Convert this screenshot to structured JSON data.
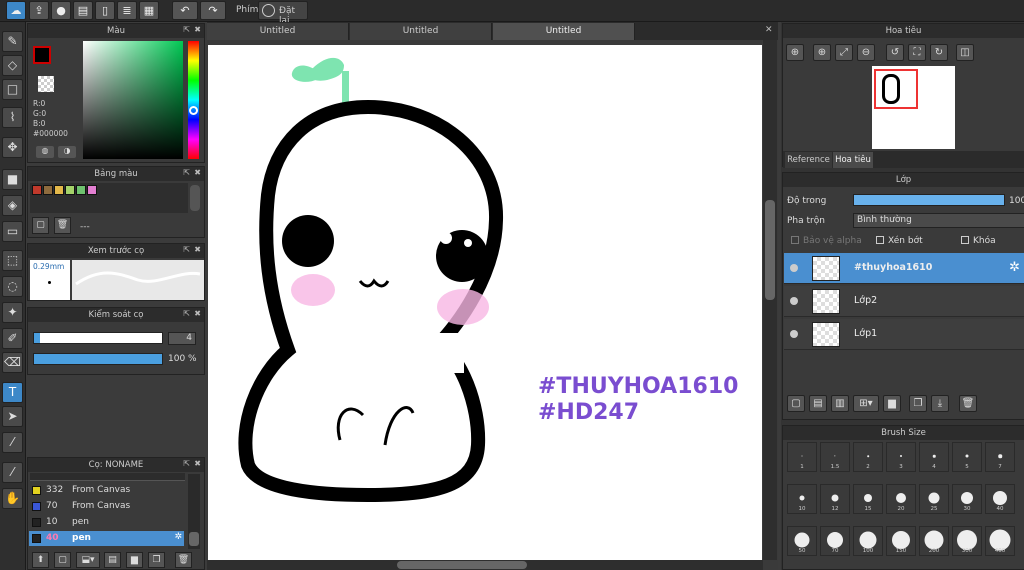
{
  "toolbar": {
    "shortcut_label": "Phím",
    "reset_label": "Đặt lại"
  },
  "colors": {
    "accent": "#3d88c8",
    "current": "#000000",
    "hashtag": "#7a4dd0"
  },
  "color_panel": {
    "title": "Màu",
    "r": "R:0",
    "g": "G:0",
    "b": "B:0",
    "hex": "#000000"
  },
  "palette_panel": {
    "title": "Bảng màu",
    "dashes": "---",
    "swatches": [
      "#c0392b",
      "#8e6b3e",
      "#e3b84a",
      "#a5d36a",
      "#6fc26f",
      "#e27fd1"
    ]
  },
  "brush_preview": {
    "title": "Xem trước cọ",
    "size": "0.29mm"
  },
  "brush_control": {
    "title": "Kiểm soát cọ",
    "size": "4",
    "opacity": "100 %",
    "opacity_fraction": 1.0
  },
  "brush_list": {
    "title": "Cọ: NONAME",
    "rows": [
      {
        "num": "332",
        "name": "From Canvas",
        "color": "#e3d21f"
      },
      {
        "num": "70",
        "name": "From Canvas",
        "color": "#3a57d8"
      },
      {
        "num": "10",
        "name": "pen",
        "color": "#222222"
      },
      {
        "num": "40",
        "name": "pen",
        "color": "#222222",
        "selected": true
      }
    ]
  },
  "tabs": [
    "Untitled",
    "Untitled",
    "Untitled"
  ],
  "canvas": {
    "hashtag1": "#THUYHOA1610",
    "hashtag2": "#HD247"
  },
  "navigator": {
    "title": "Hoa tiêu",
    "tab_reference": "Reference",
    "tab_navigator": "Hoa tiêu"
  },
  "layer_panel": {
    "title": "Lớp",
    "opacity_label": "Độ trong",
    "opacity_value": "100",
    "opacity_fraction": 1.0,
    "blend_label": "Pha trộn",
    "blend_value": "Bình thường",
    "protect_alpha": "Bảo vệ alpha",
    "clip": "Xén bớt",
    "lock": "Khóa",
    "layers": [
      {
        "name": "#thuyhoa1610",
        "selected": true
      },
      {
        "name": "Lớp2"
      },
      {
        "name": "Lớp1"
      }
    ]
  },
  "brush_size": {
    "title": "Brush Size",
    "sizes": [
      "1",
      "1.5",
      "2",
      "3",
      "4",
      "5",
      "7",
      "10",
      "12",
      "15",
      "20",
      "25",
      "30",
      "40",
      "50",
      "70",
      "100",
      "150",
      "200",
      "300",
      "400"
    ]
  }
}
